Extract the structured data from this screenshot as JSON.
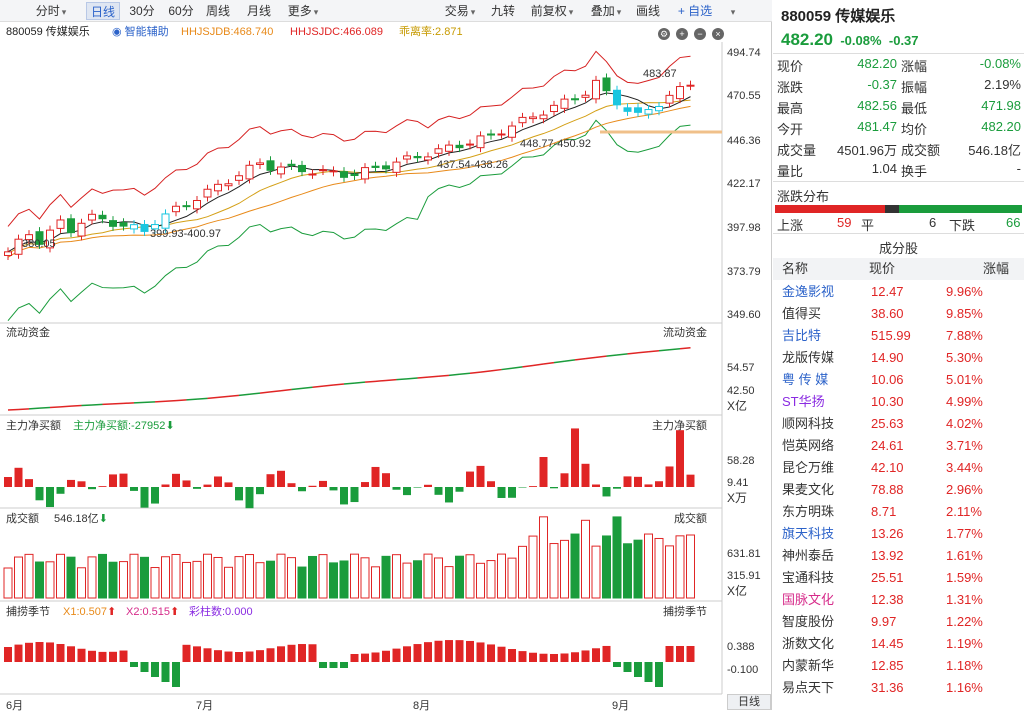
{
  "toolbar": {
    "left_label": "",
    "items": [
      {
        "label": "分时",
        "caret": "▾"
      },
      {
        "label": "日线",
        "active": true
      },
      {
        "label": "30分"
      },
      {
        "label": "60分"
      },
      {
        "label": "周线"
      },
      {
        "label": "月线"
      },
      {
        "label": "更多",
        "caret": "▾"
      }
    ],
    "right_items": [
      {
        "label": "交易",
        "caret": "▾"
      },
      {
        "label": "九转"
      },
      {
        "label": "前复权",
        "caret": "▾"
      },
      {
        "label": "叠加",
        "caret": "▾"
      },
      {
        "label": "画线"
      },
      {
        "label": "+ 自选"
      },
      {
        "label": "",
        "caret": "▾"
      }
    ]
  },
  "chart": {
    "code_name": "880059 传媒娱乐",
    "assist": "智能辅助",
    "hhjsjdb": "HHJSJDB:468.740",
    "hhjsjdc": "HHJSJDC:466.089",
    "xilv": "乖离率:2.871",
    "price_axis": [
      "494.74",
      "470.55",
      "446.36",
      "422.17",
      "397.98",
      "373.79",
      "349.60"
    ],
    "annotations": {
      "a1": "483.87",
      "a2": "448.77-450.92",
      "a3": "437.54-438.26",
      "a4": "399.93-400.97",
      "a5": "380.05"
    },
    "flow_title": "流动资金",
    "flow_right": "流动资金",
    "flow_axis": [
      "54.57",
      "42.50",
      "X亿"
    ],
    "net_title": "主力净买额",
    "net_value": "主力净买额:-27952",
    "net_right": "主力净买额",
    "net_axis": [
      "58.28",
      "9.41",
      "X万"
    ],
    "vol_title": "成交额",
    "vol_value": "546.18亿",
    "vol_right": "成交额",
    "vol_axis": [
      "631.81",
      "315.91",
      "X亿"
    ],
    "cap_title": "捕捞季节",
    "cap_x1": "X1:0.507",
    "cap_x2": "X2:0.515",
    "cap_cz": "彩柱数:0.000",
    "cap_right": "捕捞季节",
    "cap_axis": [
      "0.388",
      "-0.100"
    ],
    "months": [
      "6月",
      "7月",
      "8月",
      "9月"
    ],
    "daily_btn": "日线"
  },
  "quote": {
    "title": "880059 传媒娱乐",
    "price": "482.20",
    "chg_pct": "-0.08%",
    "chg": "-0.37",
    "rows": [
      {
        "l1": "现价",
        "v1": "482.20",
        "c1": "green",
        "l2": "涨幅",
        "v2": "-0.08%",
        "c2": "green"
      },
      {
        "l1": "涨跌",
        "v1": "-0.37",
        "c1": "green",
        "l2": "振幅",
        "v2": "2.19%",
        "c2": ""
      },
      {
        "l1": "最高",
        "v1": "482.56",
        "c1": "green",
        "l2": "最低",
        "v2": "471.98",
        "c2": "green"
      },
      {
        "l1": "今开",
        "v1": "481.47",
        "c1": "green",
        "l2": "均价",
        "v2": "482.20",
        "c2": "green"
      },
      {
        "l1": "成交量",
        "v1": "4501.96万",
        "c1": "",
        "l2": "成交额",
        "v2": "546.18亿",
        "c2": ""
      },
      {
        "l1": "量比",
        "v1": "1.04",
        "c1": "",
        "l2": "换手",
        "v2": "-",
        "c2": ""
      }
    ],
    "dist_title": "涨跌分布",
    "up_label": "上涨",
    "up": "59",
    "flat_label": "平",
    "flat": "6",
    "down_label": "下跌",
    "down": "66",
    "comp_title": "成分股",
    "comp_head": [
      "名称",
      "现价",
      "涨幅"
    ],
    "components": [
      {
        "name": "金逸影视",
        "price": "12.47",
        "pct": "9.96%",
        "nc": "blue"
      },
      {
        "name": "值得买",
        "price": "38.60",
        "pct": "9.85%",
        "nc": ""
      },
      {
        "name": "吉比特",
        "price": "515.99",
        "pct": "7.88%",
        "nc": "blue"
      },
      {
        "name": "龙版传媒",
        "price": "14.90",
        "pct": "5.30%",
        "nc": ""
      },
      {
        "name": "粤 传 媒",
        "price": "10.06",
        "pct": "5.01%",
        "nc": "blue"
      },
      {
        "name": "ST华扬",
        "price": "10.30",
        "pct": "4.99%",
        "nc": "purple"
      },
      {
        "name": "顺网科技",
        "price": "25.63",
        "pct": "4.02%",
        "nc": ""
      },
      {
        "name": "恺英网络",
        "price": "24.61",
        "pct": "3.71%",
        "nc": ""
      },
      {
        "name": "昆仑万维",
        "price": "42.10",
        "pct": "3.44%",
        "nc": ""
      },
      {
        "name": "果麦文化",
        "price": "78.88",
        "pct": "2.96%",
        "nc": ""
      },
      {
        "name": "东方明珠",
        "price": "8.71",
        "pct": "2.11%",
        "nc": ""
      },
      {
        "name": "旗天科技",
        "price": "13.26",
        "pct": "1.77%",
        "nc": "blue"
      },
      {
        "name": "神州泰岳",
        "price": "13.92",
        "pct": "1.61%",
        "nc": ""
      },
      {
        "name": "宝通科技",
        "price": "25.51",
        "pct": "1.59%",
        "nc": ""
      },
      {
        "name": "国脉文化",
        "price": "12.38",
        "pct": "1.31%",
        "nc": "pink"
      },
      {
        "name": "智度股份",
        "price": "9.97",
        "pct": "1.22%",
        "nc": ""
      },
      {
        "name": "浙数文化",
        "price": "14.45",
        "pct": "1.19%",
        "nc": ""
      },
      {
        "name": "内蒙新华",
        "price": "12.85",
        "pct": "1.18%",
        "nc": ""
      },
      {
        "name": "易点天下",
        "price": "31.36",
        "pct": "1.16%",
        "nc": ""
      }
    ]
  }
}
